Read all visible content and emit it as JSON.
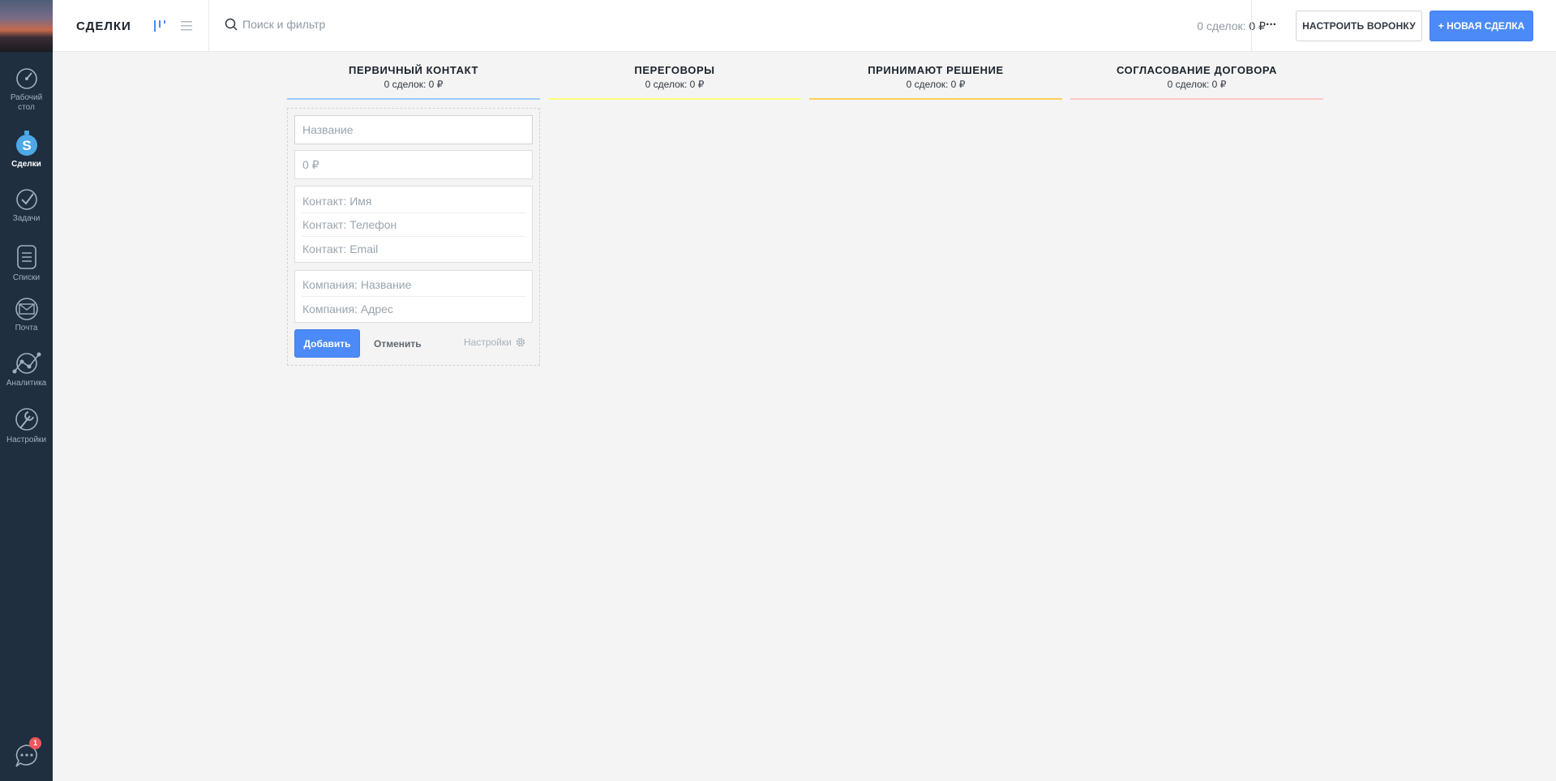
{
  "colors": {
    "sidebar_bg": "#1f2f3f",
    "accent_blue": "#4c8bf7",
    "stage_1": "#99ccfd",
    "stage_2": "#fffd7f",
    "stage_3": "#ffce5a",
    "stage_4": "#ffc8c8"
  },
  "sidebar": {
    "items": [
      {
        "label": "Рабочий стол",
        "icon": "dashboard-icon"
      },
      {
        "label": "Сделки",
        "icon": "deals-icon",
        "active": true
      },
      {
        "label": "Задачи",
        "icon": "tasks-icon"
      },
      {
        "label": "Списки",
        "icon": "lists-icon"
      },
      {
        "label": "Почта",
        "icon": "mail-icon"
      },
      {
        "label": "Аналитика",
        "icon": "analytics-icon"
      },
      {
        "label": "Настройки",
        "icon": "settings-icon"
      }
    ],
    "chat_badge": "1"
  },
  "header": {
    "title": "СДЕЛКИ",
    "search_placeholder": "Поиск и фильтр",
    "summary_count": "0 сделок:",
    "summary_sum": "0 ₽",
    "more_label": "···",
    "setup_button": "НАСТРОИТЬ ВОРОНКУ",
    "new_button": "+ НОВАЯ СДЕЛКА"
  },
  "columns": [
    {
      "title": "ПЕРВИЧНЫЙ КОНТАКТ",
      "count": "0 сделок: 0 ₽"
    },
    {
      "title": "ПЕРЕГОВОРЫ",
      "count": "0 сделок: 0 ₽"
    },
    {
      "title": "ПРИНИМАЮТ РЕШЕНИЕ",
      "count": "0 сделок: 0 ₽"
    },
    {
      "title": "СОГЛАСОВАНИЕ ДОГОВОРА",
      "count": "0 сделок: 0 ₽"
    }
  ],
  "form": {
    "name_placeholder": "Название",
    "price_placeholder": "0 ₽",
    "contact_name_placeholder": "Контакт: Имя",
    "contact_phone_placeholder": "Контакт: Телефон",
    "contact_email_placeholder": "Контакт: Email",
    "company_name_placeholder": "Компания: Название",
    "company_address_placeholder": "Компания: Адрес",
    "add_button": "Добавить",
    "cancel_button": "Отменить",
    "settings_label": "Настройки"
  }
}
